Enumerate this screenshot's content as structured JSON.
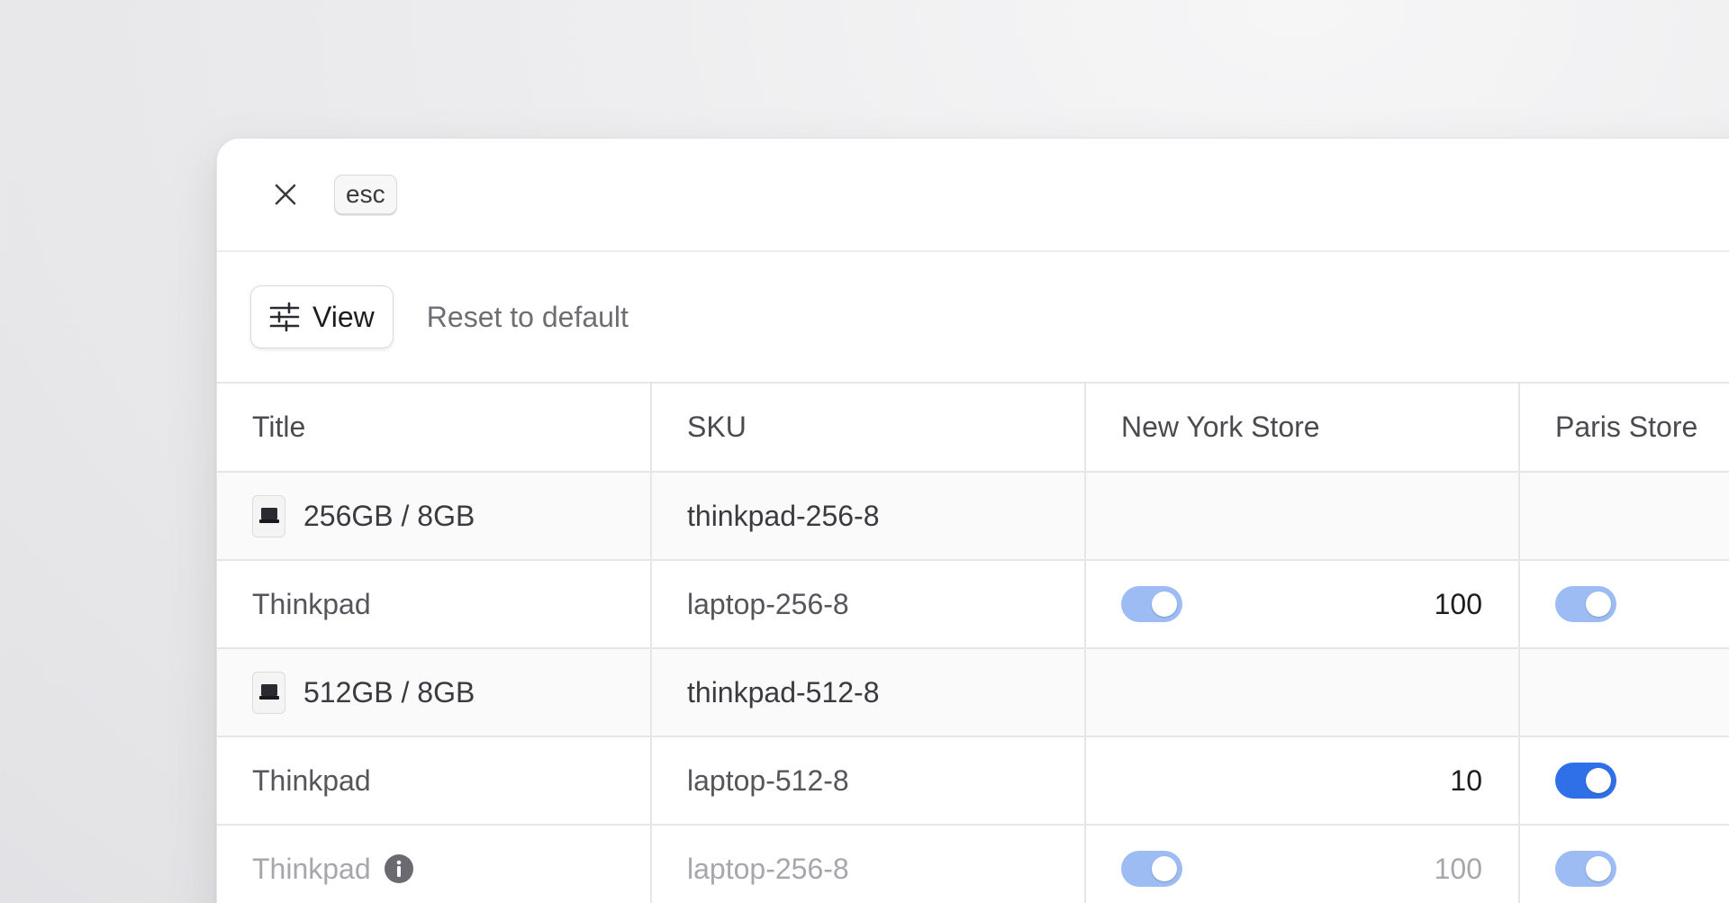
{
  "topbar": {
    "close_icon": "close-icon",
    "esc_label": "esc"
  },
  "toolbar": {
    "view_label": "View",
    "view_icon": "sliders-icon",
    "reset_label": "Reset to default"
  },
  "colors": {
    "toggle_on": "#2f6fe8",
    "toggle_on_light": "#9dbcf4"
  },
  "table": {
    "columns": [
      "Title",
      "SKU",
      "New York Store",
      "Paris Store"
    ],
    "rows": [
      {
        "type": "group",
        "title": "256GB / 8GB",
        "sku": "thinkpad-256-8",
        "thumbnail": "laptop-thumbnail"
      },
      {
        "type": "item",
        "title": "Thinkpad",
        "sku": "laptop-256-8",
        "ny_toggle": "light",
        "ny_qty": "100",
        "paris_toggle": "light"
      },
      {
        "type": "group",
        "title": "512GB / 8GB",
        "sku": "thinkpad-512-8",
        "thumbnail": "laptop-thumbnail"
      },
      {
        "type": "item",
        "title": "Thinkpad",
        "sku": "laptop-512-8",
        "ny_qty": "10",
        "paris_toggle": "dark"
      },
      {
        "type": "faded",
        "title": "Thinkpad",
        "sku": "laptop-256-8",
        "info_icon": "info-icon",
        "ny_toggle": "light",
        "ny_qty": "100",
        "paris_toggle": "light"
      }
    ]
  }
}
